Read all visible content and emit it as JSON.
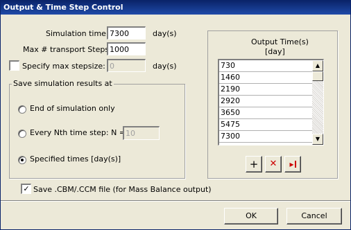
{
  "window": {
    "title": "Output & Time Step Control"
  },
  "simulation_time": {
    "label": "Simulation time:",
    "value": "7300",
    "unit": "day(s)"
  },
  "max_transport_steps": {
    "label": "Max # transport Steps:",
    "value": "1000"
  },
  "max_stepsize": {
    "label": "Specify max stepsize:",
    "value": "0",
    "unit": "day(s)",
    "checked": false
  },
  "save_group": {
    "title": "Save simulation results at",
    "options": [
      {
        "label": "End of simulation only",
        "checked": false
      },
      {
        "label": "Every Nth time step: N =",
        "checked": false,
        "n_value": "10"
      },
      {
        "label": "Specified times [day(s)]",
        "checked": true
      }
    ]
  },
  "output_times": {
    "title_line1": "Output Time(s)",
    "title_line2": "[day]",
    "values": [
      "730",
      "1460",
      "2190",
      "2920",
      "3650",
      "5475",
      "7300"
    ]
  },
  "tools": {
    "add": "+",
    "delete": "✕",
    "insert": "▸"
  },
  "save_cbm": {
    "label": "Save .CBM/.CCM  file (for Mass Balance output)",
    "checked": true
  },
  "footer": {
    "ok": "OK",
    "cancel": "Cancel"
  },
  "colors": {
    "titlebar": "#0a246a",
    "dialog_bg": "#ece9d8",
    "delete_red": "#cc0000"
  }
}
